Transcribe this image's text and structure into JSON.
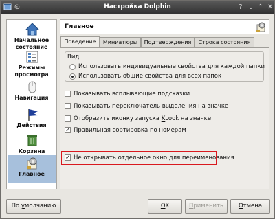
{
  "window": {
    "title": "Настройка Dolphin"
  },
  "sidebar": {
    "items": [
      {
        "label_l1": "Начальное",
        "label_l2": "состояние",
        "icon": "home-icon"
      },
      {
        "label_l1": "Режимы",
        "label_l2": "просмотра",
        "icon": "view-modes-icon"
      },
      {
        "label_l1": "Навигация",
        "label_l2": "",
        "icon": "mouse-icon"
      },
      {
        "label_l1": "Действия",
        "label_l2": "",
        "icon": "flag-icon"
      },
      {
        "label_l1": "Корзина",
        "label_l2": "",
        "icon": "trash-icon"
      },
      {
        "label_l1": "Главное",
        "label_l2": "",
        "icon": "general-settings-icon",
        "active": true
      }
    ]
  },
  "header": {
    "title": "Главное",
    "icon": "settings-icon"
  },
  "tabs": [
    {
      "label": "Поведение",
      "active": true
    },
    {
      "label": "Миниатюры"
    },
    {
      "label": "Подтверждения"
    },
    {
      "label": "Строка состояния"
    }
  ],
  "view_group": {
    "title": "Вид",
    "options": [
      {
        "label": "Использовать индивидуальные свойства для каждой папки",
        "selected": false
      },
      {
        "label": "Использовать общие свойства для всех папок",
        "selected": true
      }
    ]
  },
  "checkboxes": [
    {
      "label": "Показывать всплывающие подсказки",
      "checked": false
    },
    {
      "label": "Показывать переключатель выделения на значке",
      "checked": false
    },
    {
      "label_pre": "Отобразить иконку запуска ",
      "label_u": "K",
      "label_post": "Look на значке",
      "checked": false
    },
    {
      "label": "Правильная сортировка по номерам",
      "checked": true
    },
    {
      "label": "Не открывать отдельное окно для переименования",
      "checked": true
    }
  ],
  "buttons": {
    "defaults_pre": "По ",
    "defaults_u": "у",
    "defaults_post": "молчанию",
    "ok_u": "O",
    "ok_post": "K",
    "apply_pre": "",
    "apply_u": "П",
    "apply_post": "рименить",
    "cancel_pre": "",
    "cancel_u": "О",
    "cancel_post": "тмена"
  },
  "colors": {
    "highlight_border": "#d9191f",
    "sidebar_active": "#a7c0dc"
  }
}
